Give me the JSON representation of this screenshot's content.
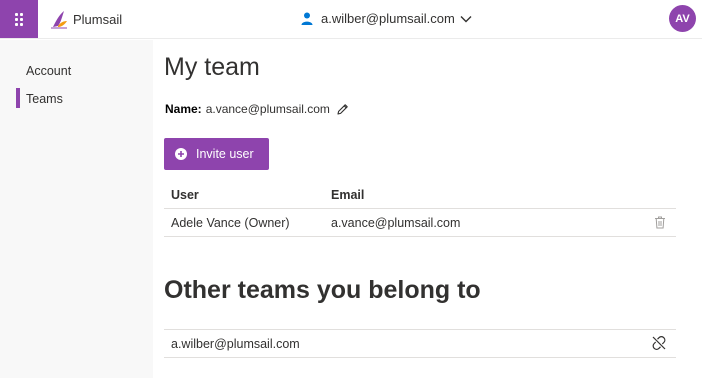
{
  "header": {
    "brand": "Plumsail",
    "user_email": "a.wilber@plumsail.com",
    "avatar_initials": "AV",
    "accent_color": "#8e44ad"
  },
  "sidebar": {
    "items": [
      {
        "label": "Account",
        "active": false
      },
      {
        "label": "Teams",
        "active": true
      }
    ]
  },
  "main": {
    "title": "My team",
    "name_label": "Name:",
    "name_value": "a.vance@plumsail.com",
    "invite_label": "Invite user",
    "table": {
      "columns": [
        "User",
        "Email"
      ],
      "rows": [
        {
          "user": "Adele Vance (Owner)",
          "email": "a.vance@plumsail.com"
        }
      ]
    },
    "other_title": "Other teams you belong to",
    "other_teams": [
      {
        "label": "a.wilber@plumsail.com"
      }
    ]
  },
  "icons": {
    "waffle": "app-launcher-icon",
    "logo": "plumsail-logo",
    "person": "person-icon",
    "chevron": "chevron-down-icon",
    "edit": "pencil-icon",
    "add": "plus-circle-icon",
    "delete": "trash-icon",
    "leave": "unlink-icon"
  }
}
